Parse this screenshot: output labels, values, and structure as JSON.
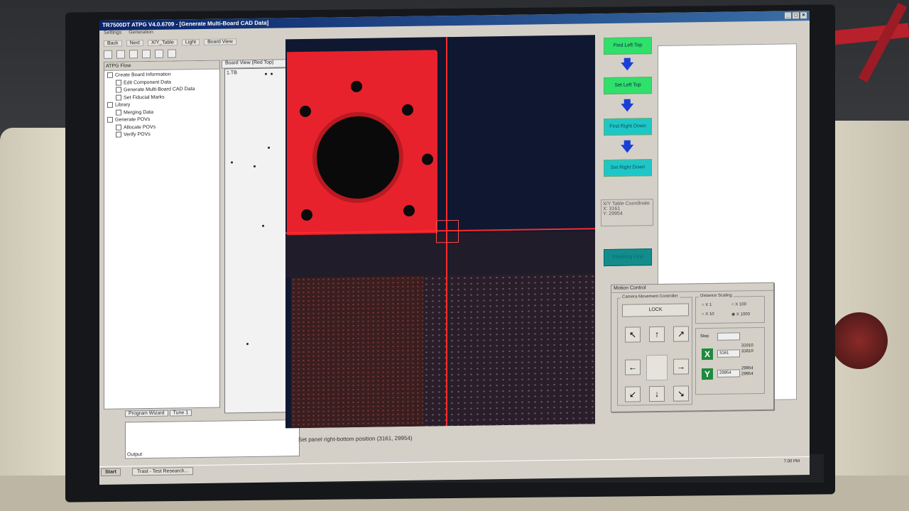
{
  "window": {
    "title": "TR7500DT ATPG V4.0.6709 - [Generate Multi-Board CAD Data]"
  },
  "menu": [
    "Settings",
    "Generation"
  ],
  "toolbar": [
    "Back",
    "Next",
    "X/Y_Table",
    "Light",
    "Board View"
  ],
  "flow_panel": {
    "title": "ATPG Flow",
    "items": [
      {
        "label": "Create Board Information",
        "level": 1
      },
      {
        "label": "Edit Component Data",
        "level": 2
      },
      {
        "label": "Generate Multi-Board CAD Data",
        "level": 2
      },
      {
        "label": "Set Fiducial Marks",
        "level": 2
      },
      {
        "label": "Library",
        "level": 1
      },
      {
        "label": "Merging Data",
        "level": 2
      },
      {
        "label": "Generate POVs",
        "level": 1
      },
      {
        "label": "Allocate POVs",
        "level": 2
      },
      {
        "label": "Verify POVs",
        "level": 2
      }
    ]
  },
  "bottom_tabs": [
    "Program Wizard",
    "Tune 1"
  ],
  "output_label": "Output",
  "board_view": {
    "tab": "Board View (Red Top)",
    "label": "1.TB"
  },
  "steps": {
    "find_left_top": "Find Left Top",
    "set_left_top": "Set Left Top",
    "find_right_down": "Find Right Down",
    "set_right_down": "Set Right Down",
    "finish": "Finishing Find"
  },
  "xy_table": {
    "title": "X/Y Table Coordinate",
    "x": "X: 3161",
    "y": "Y: 29954"
  },
  "motion": {
    "title": "Motion Control",
    "camera_group": "Camera Movement Controller",
    "lock": "LOCK",
    "scale_group": "Distance Scaling",
    "scales": [
      "X 1",
      "X 100",
      "X 10",
      "X 1000"
    ],
    "step_label": "Step",
    "x_axis": "X",
    "y_axis": "Y",
    "x_value": "3161",
    "y_value": "29954",
    "x_range": [
      "31010",
      "31610"
    ],
    "y_range": [
      "29954",
      "29954"
    ]
  },
  "status": "Set panel right-bottom position (3161, 29954)",
  "taskbar": {
    "start": "Start",
    "task": "Trast - Test Research...",
    "clock": "7:00 PM"
  },
  "arrow_glyph": "🡇"
}
